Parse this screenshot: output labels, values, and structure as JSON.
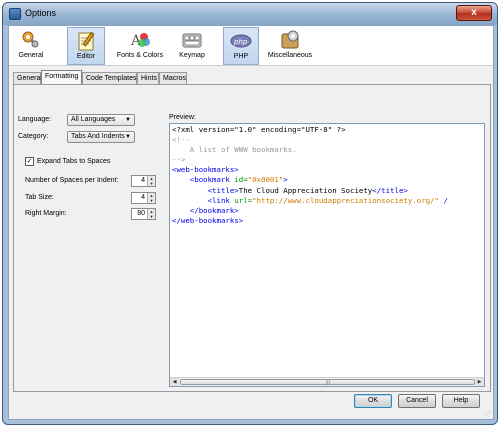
{
  "window": {
    "title": "Options",
    "close_glyph": "x"
  },
  "categories": [
    {
      "label": "General",
      "icon": "general-tools-icon",
      "selected": false
    },
    {
      "label": "Editor",
      "icon": "editor-notepad-icon",
      "selected": true
    },
    {
      "label": "Fonts & Colors",
      "icon": "fonts-colors-icon",
      "selected": false
    },
    {
      "label": "Keymap",
      "icon": "keymap-keyboard-icon",
      "selected": false
    },
    {
      "label": "PHP",
      "icon": "php-icon",
      "selected": true
    },
    {
      "label": "Miscellaneous",
      "icon": "miscellaneous-icon",
      "selected": false
    }
  ],
  "tabs": [
    {
      "label": "General"
    },
    {
      "label": "Formatting"
    },
    {
      "label": "Code Templates"
    },
    {
      "label": "Hints"
    },
    {
      "label": "Macros"
    }
  ],
  "active_tab": "Formatting",
  "form": {
    "language_label": "Language:",
    "language_value": "All Languages",
    "category_label": "Category:",
    "category_value": "Tabs And Indents",
    "expand_tabs_label": "Expand Tabs to Spaces",
    "expand_tabs_checked": true,
    "spaces_per_indent_label": "Number of Spaces per Indent:",
    "spaces_per_indent_value": "4",
    "tab_size_label": "Tab Size:",
    "tab_size_value": "4",
    "right_margin_label": "Right Margin:",
    "right_margin_value": "80"
  },
  "preview": {
    "label": "Preview:",
    "lines": [
      [
        {
          "t": "<?xml version=\"1.0\" encoding=\"UTF-8\" ?>",
          "c": "pi"
        }
      ],
      [
        {
          "t": "<!--",
          "c": "comment"
        }
      ],
      [
        {
          "t": "    A list of WWW bookmarks.",
          "c": "comment"
        }
      ],
      [
        {
          "t": "-->",
          "c": "comment"
        }
      ],
      [
        {
          "t": "<web-bookmarks>",
          "c": "tag"
        }
      ],
      [
        {
          "t": "    <bookmark ",
          "c": "tag"
        },
        {
          "t": "id=",
          "c": "attr"
        },
        {
          "t": "\"0x0001\"",
          "c": "val"
        },
        {
          "t": ">",
          "c": "tag"
        }
      ],
      [
        {
          "t": "        <title>",
          "c": "tag"
        },
        {
          "t": "The Cloud Appreciation Society",
          "c": "text"
        },
        {
          "t": "</title>",
          "c": "tag"
        }
      ],
      [
        {
          "t": "        <link ",
          "c": "tag"
        },
        {
          "t": "url=",
          "c": "attr"
        },
        {
          "t": "\"http://www.cloudappreciationsociety.org/\"",
          "c": "val"
        },
        {
          "t": " /",
          "c": "tag"
        }
      ],
      [
        {
          "t": "    </bookmark>",
          "c": "tag"
        }
      ],
      [
        {
          "t": "</web-bookmarks>",
          "c": "tag"
        }
      ]
    ]
  },
  "buttons": {
    "ok": "OK",
    "cancel": "Cancel",
    "help": "Help"
  }
}
